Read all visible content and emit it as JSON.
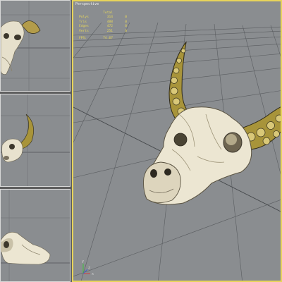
{
  "viewport": {
    "label": "Perspective",
    "stats": {
      "header": "Total",
      "rows": [
        {
          "key": "Polys",
          "total": "314",
          "selected": "0"
        },
        {
          "key": "Tris",
          "total": "488",
          "selected": "0"
        },
        {
          "key": "Edges",
          "total": "472",
          "selected": "0"
        },
        {
          "key": "Verts",
          "total": "251",
          "selected": "0"
        }
      ],
      "fps_key": "FPS:",
      "fps_value": "74.67"
    }
  },
  "axis_labels": {
    "x": "x",
    "y": "y",
    "z": "z"
  },
  "colors": {
    "viewport_bg": "#8a8d90",
    "active_border": "#e7d45a",
    "stats_text": "#e8d85a",
    "grid_line": "#5a5d60",
    "skull": "#ece6d2",
    "horn": "#a8943a"
  }
}
